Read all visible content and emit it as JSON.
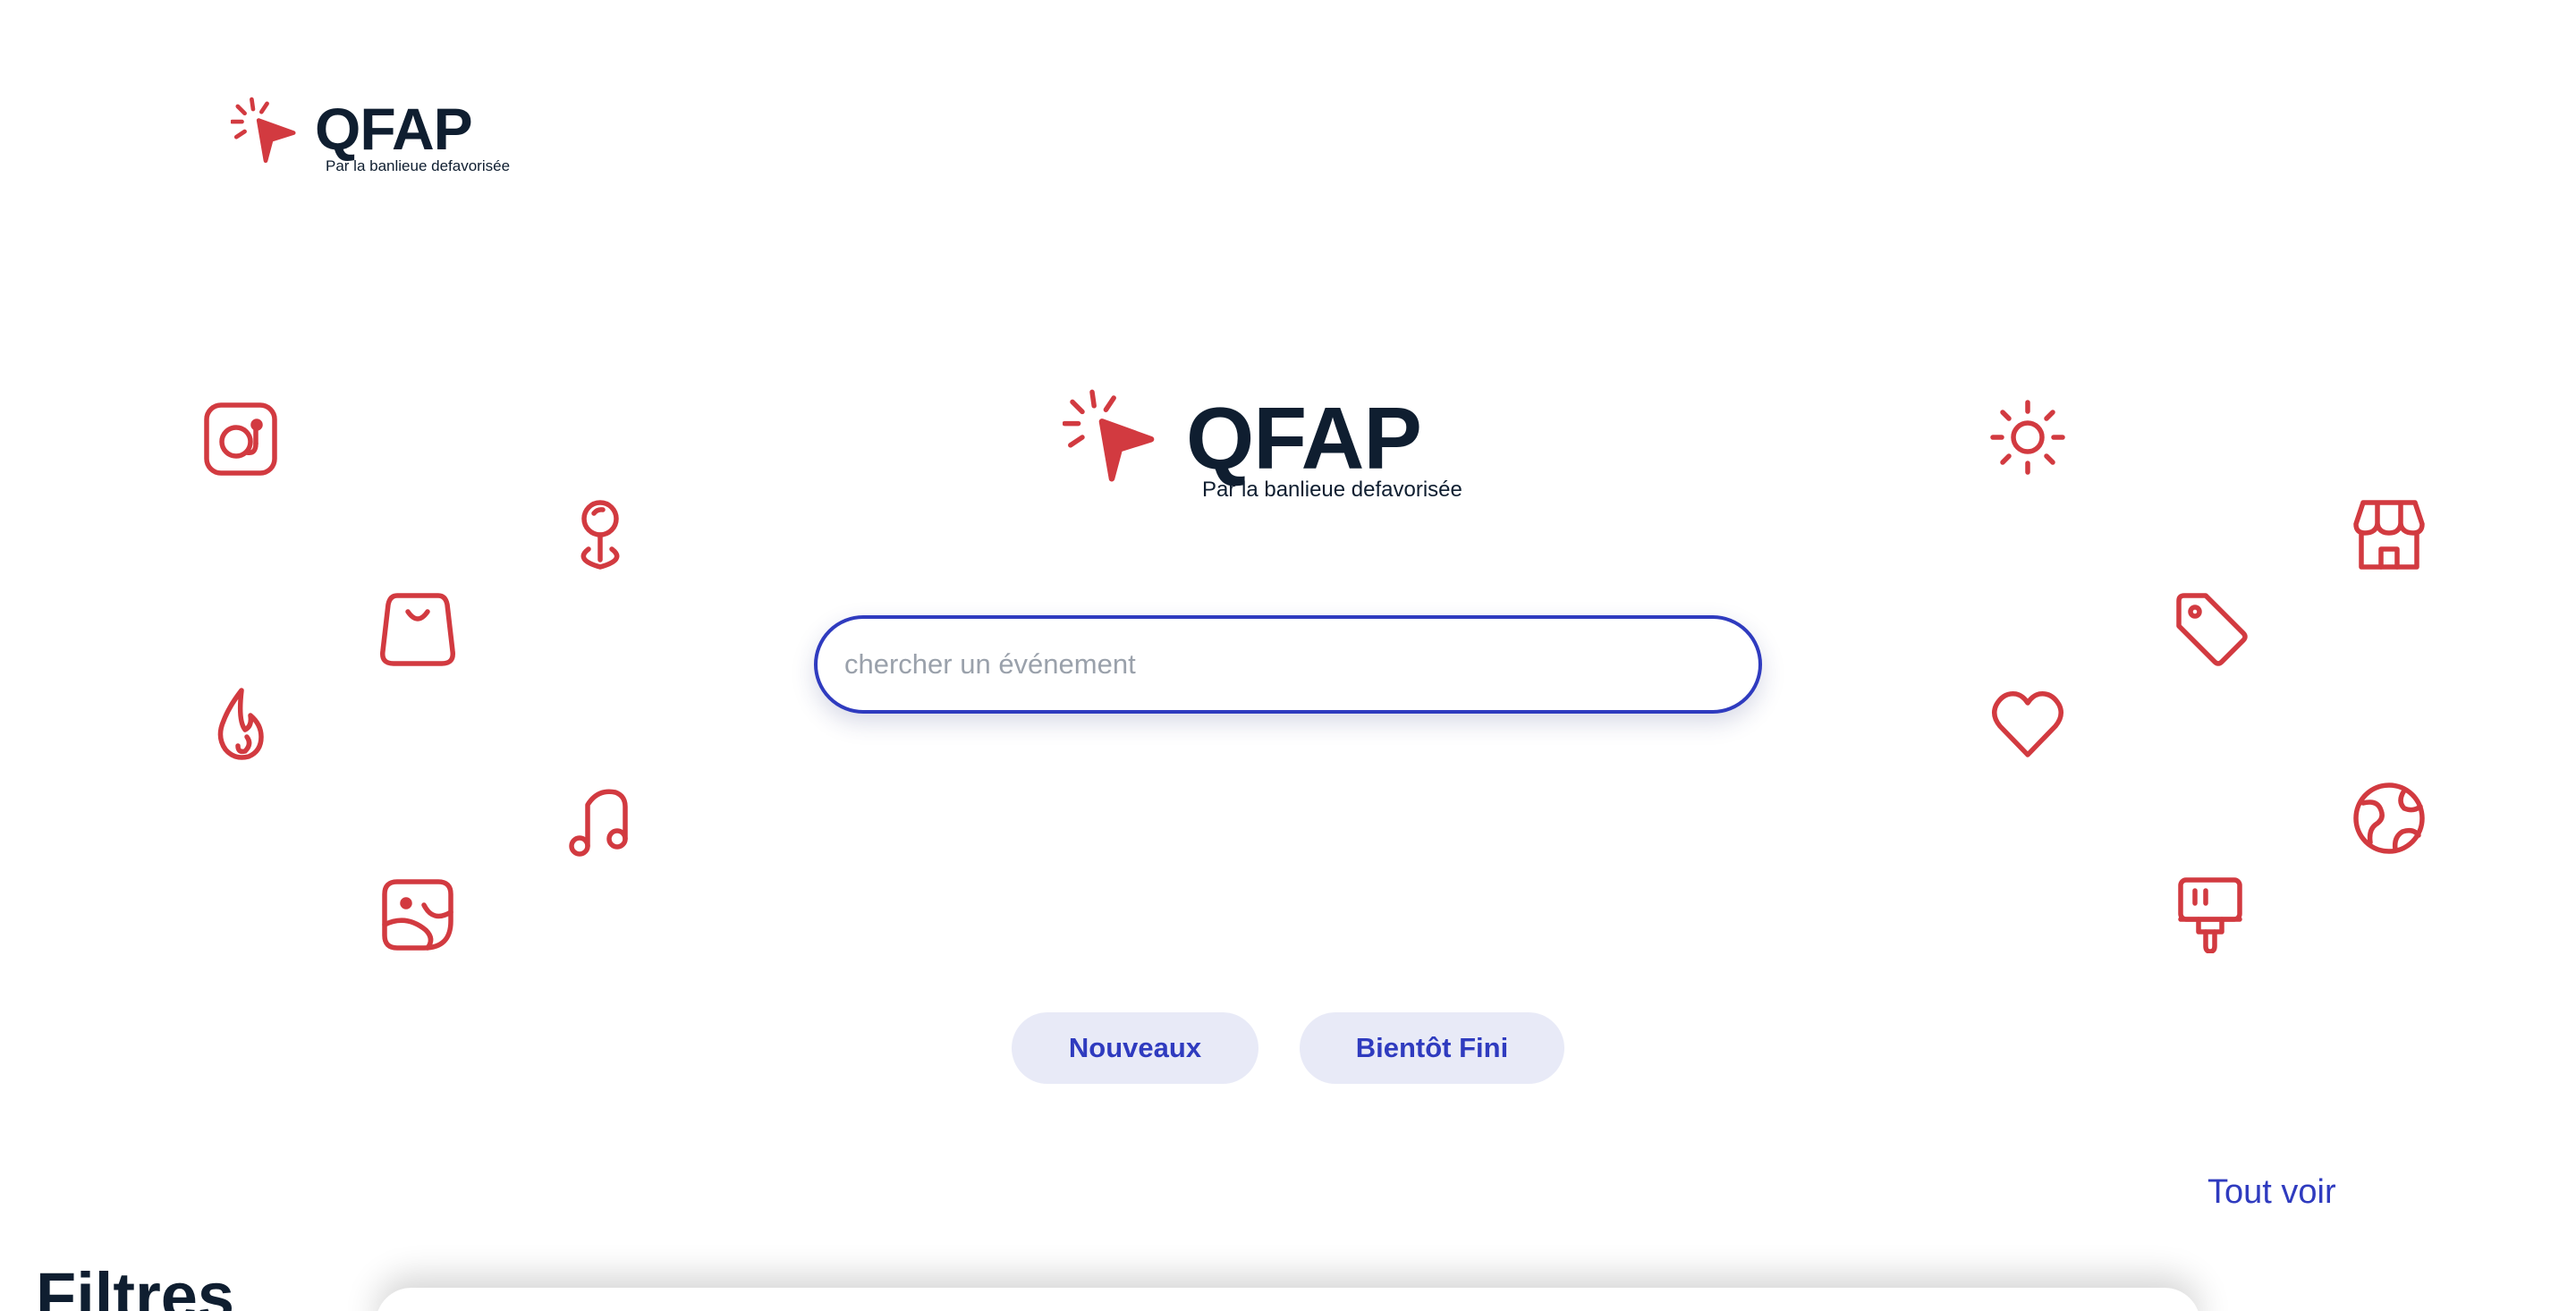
{
  "header": {
    "logo_word": "QFAP",
    "logo_tagline": "Par la banlieue defavorisée"
  },
  "hero": {
    "logo_word": "QFAP",
    "logo_tagline": "Par la banlieue defavorisée"
  },
  "search": {
    "placeholder": "chercher un événement",
    "value": ""
  },
  "quick_filters": {
    "new_label": "Nouveaux",
    "ending_soon_label": "Bientôt Fini"
  },
  "see_all_label": "Tout voir",
  "filters_heading": "Filtres",
  "colors": {
    "accent": "#d23a40",
    "primary": "#2f3bbf",
    "text": "#0f1e30",
    "pill_bg": "#e8eaf7"
  },
  "decor_icons": [
    "camera-icon",
    "map-pin-icon",
    "shopping-bag-icon",
    "flame-icon",
    "music-note-icon",
    "sticker-icon",
    "sun-icon",
    "store-icon",
    "tag-icon",
    "heart-icon",
    "globe-icon",
    "paint-roller-icon"
  ]
}
